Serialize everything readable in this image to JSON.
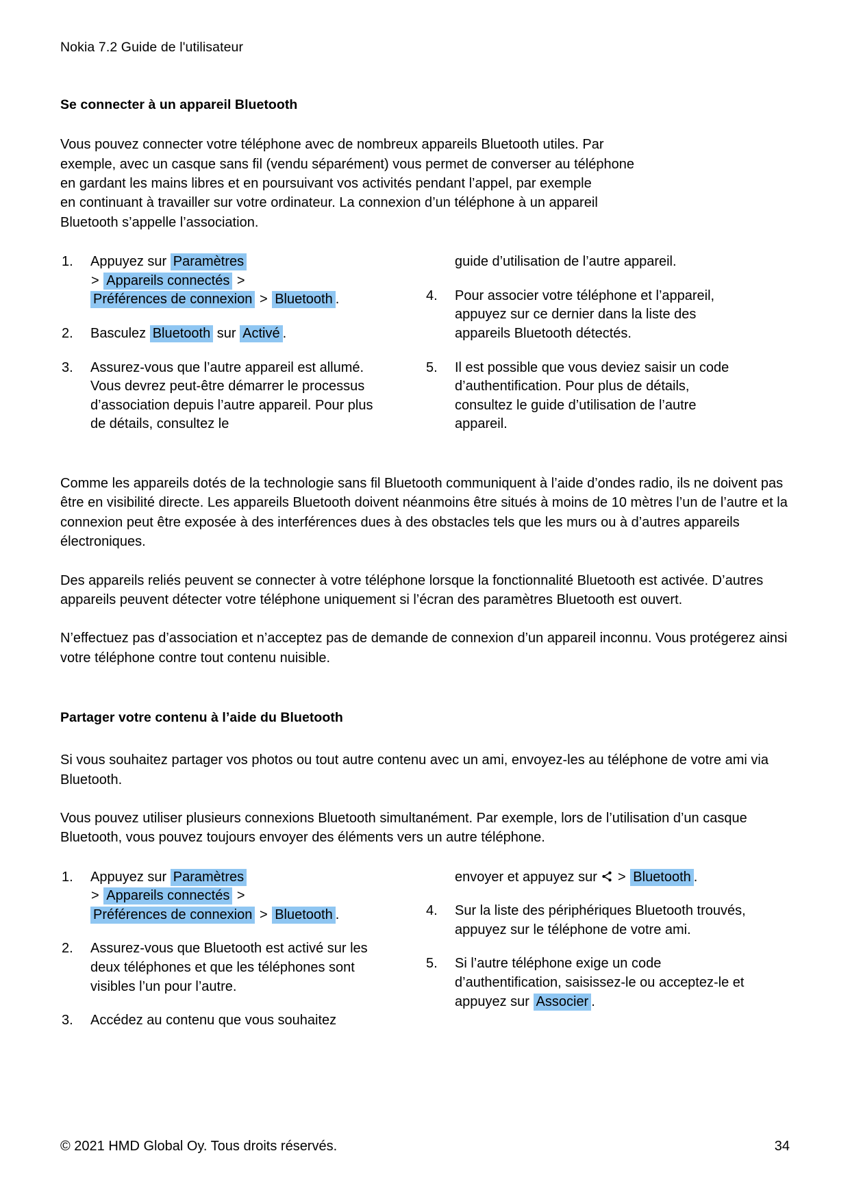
{
  "document": {
    "running_head": "Nokia 7.2 Guide de l'utilisateur",
    "footer_copyright": "© 2021 HMD Global Oy. Tous droits réservés.",
    "page_number": "34",
    "highlight_color": "#8fc6f2"
  },
  "section1": {
    "heading": "Se connecter à un appareil Bluetooth",
    "intro_lines": [
      "Vous pouvez connecter votre téléphone avec de nombreux appareils Bluetooth utiles. Par",
      "exemple, avec un casque sans fil (vendu séparément) vous permet de converser au téléphone",
      "en gardant les mains libres et en poursuivant vos activités pendant l’appel, par exemple",
      "en continuant à travailler sur votre ordinateur. La connexion d’un téléphone à un appareil",
      "Bluetooth s’appelle l’association."
    ],
    "steps_left": {
      "s1_num": "1.",
      "s1_a": "Appuyez sur",
      "s1_hl1": "Paramètres",
      "s1_gt1": ">",
      "s1_hl2": "Appareils connectés",
      "s1_gt2": ">",
      "s1_hl3": "Préférences de connexion",
      "s1_gt3": ">",
      "s1_hl4": "Bluetooth",
      "s1_end": ".",
      "s2_num": "2.",
      "s2_a": "Basculez",
      "s2_hl1": "Bluetooth",
      "s2_b": "sur",
      "s2_hl2": "Activé",
      "s2_end": ".",
      "s3_num": "3.",
      "s3_text": "Assurez-vous que l’autre appareil est allumé. Vous devrez peut-être démarrer le processus d’association depuis l’autre appareil. Pour plus de détails, consultez le"
    },
    "steps_right": {
      "cont_text": "guide d’utilisation de l’autre appareil.",
      "s4_num": "4.",
      "s4_text": "Pour associer votre téléphone et l’appareil, appuyez sur ce dernier dans la liste des appareils Bluetooth détectés.",
      "s5_num": "5.",
      "s5_text": "Il est possible que vous deviez saisir un code d’authentification. Pour plus de détails, consultez le guide d’utilisation de l’autre appareil."
    },
    "paragraphs": [
      "Comme les appareils dotés de la technologie sans fil Bluetooth communiquent à l’aide d’ondes radio, ils ne doivent pas être en visibilité directe. Les appareils Bluetooth doivent néanmoins être situés à moins de 10 mètres l’un de l’autre et la connexion peut être exposée à des interférences dues à des obstacles tels que les murs ou à d’autres appareils électroniques.",
      "Des appareils reliés peuvent se connecter à votre téléphone lorsque la fonctionnalité Bluetooth est activée. D’autres appareils peuvent détecter votre téléphone uniquement si l’écran des paramètres Bluetooth est ouvert.",
      "N’effectuez pas d’association et n’acceptez pas de demande de connexion d’un appareil inconnu. Vous protégerez ainsi votre téléphone contre tout contenu nuisible."
    ]
  },
  "section2": {
    "heading": "Partager votre contenu à l’aide du Bluetooth",
    "paragraphs": [
      "Si vous souhaitez partager vos photos ou tout autre contenu avec un ami, envoyez-les au téléphone de votre ami via Bluetooth.",
      "Vous pouvez utiliser plusieurs connexions Bluetooth simultanément. Par exemple, lors de l’utilisation d’un casque Bluetooth, vous pouvez toujours envoyer des éléments vers un autre téléphone."
    ],
    "steps_left": {
      "s1_num": "1.",
      "s1_a": "Appuyez sur",
      "s1_hl1": "Paramètres",
      "s1_gt1": ">",
      "s1_hl2": "Appareils connectés",
      "s1_gt2": ">",
      "s1_hl3": "Préférences de connexion",
      "s1_gt3": ">",
      "s1_hl4": "Bluetooth",
      "s1_end": ".",
      "s2_num": "2.",
      "s2_text": "Assurez-vous que Bluetooth est activé sur les deux téléphones et que les téléphones sont visibles l’un pour l’autre.",
      "s3_num": "3.",
      "s3_text": "Accédez au contenu que vous souhaitez"
    },
    "steps_right": {
      "cont_a": "envoyer et appuyez sur",
      "cont_icon": "share-icon",
      "cont_gt": ">",
      "cont_hl": "Bluetooth",
      "cont_end": ".",
      "s4_num": "4.",
      "s4_text": "Sur la liste des périphériques Bluetooth trouvés, appuyez sur le téléphone de votre ami.",
      "s5_num": "5.",
      "s5_a": "Si l’autre téléphone exige un code d’authentification, saisissez-le ou acceptez-le et appuyez sur",
      "s5_hl": "Associer",
      "s5_end": "."
    }
  }
}
